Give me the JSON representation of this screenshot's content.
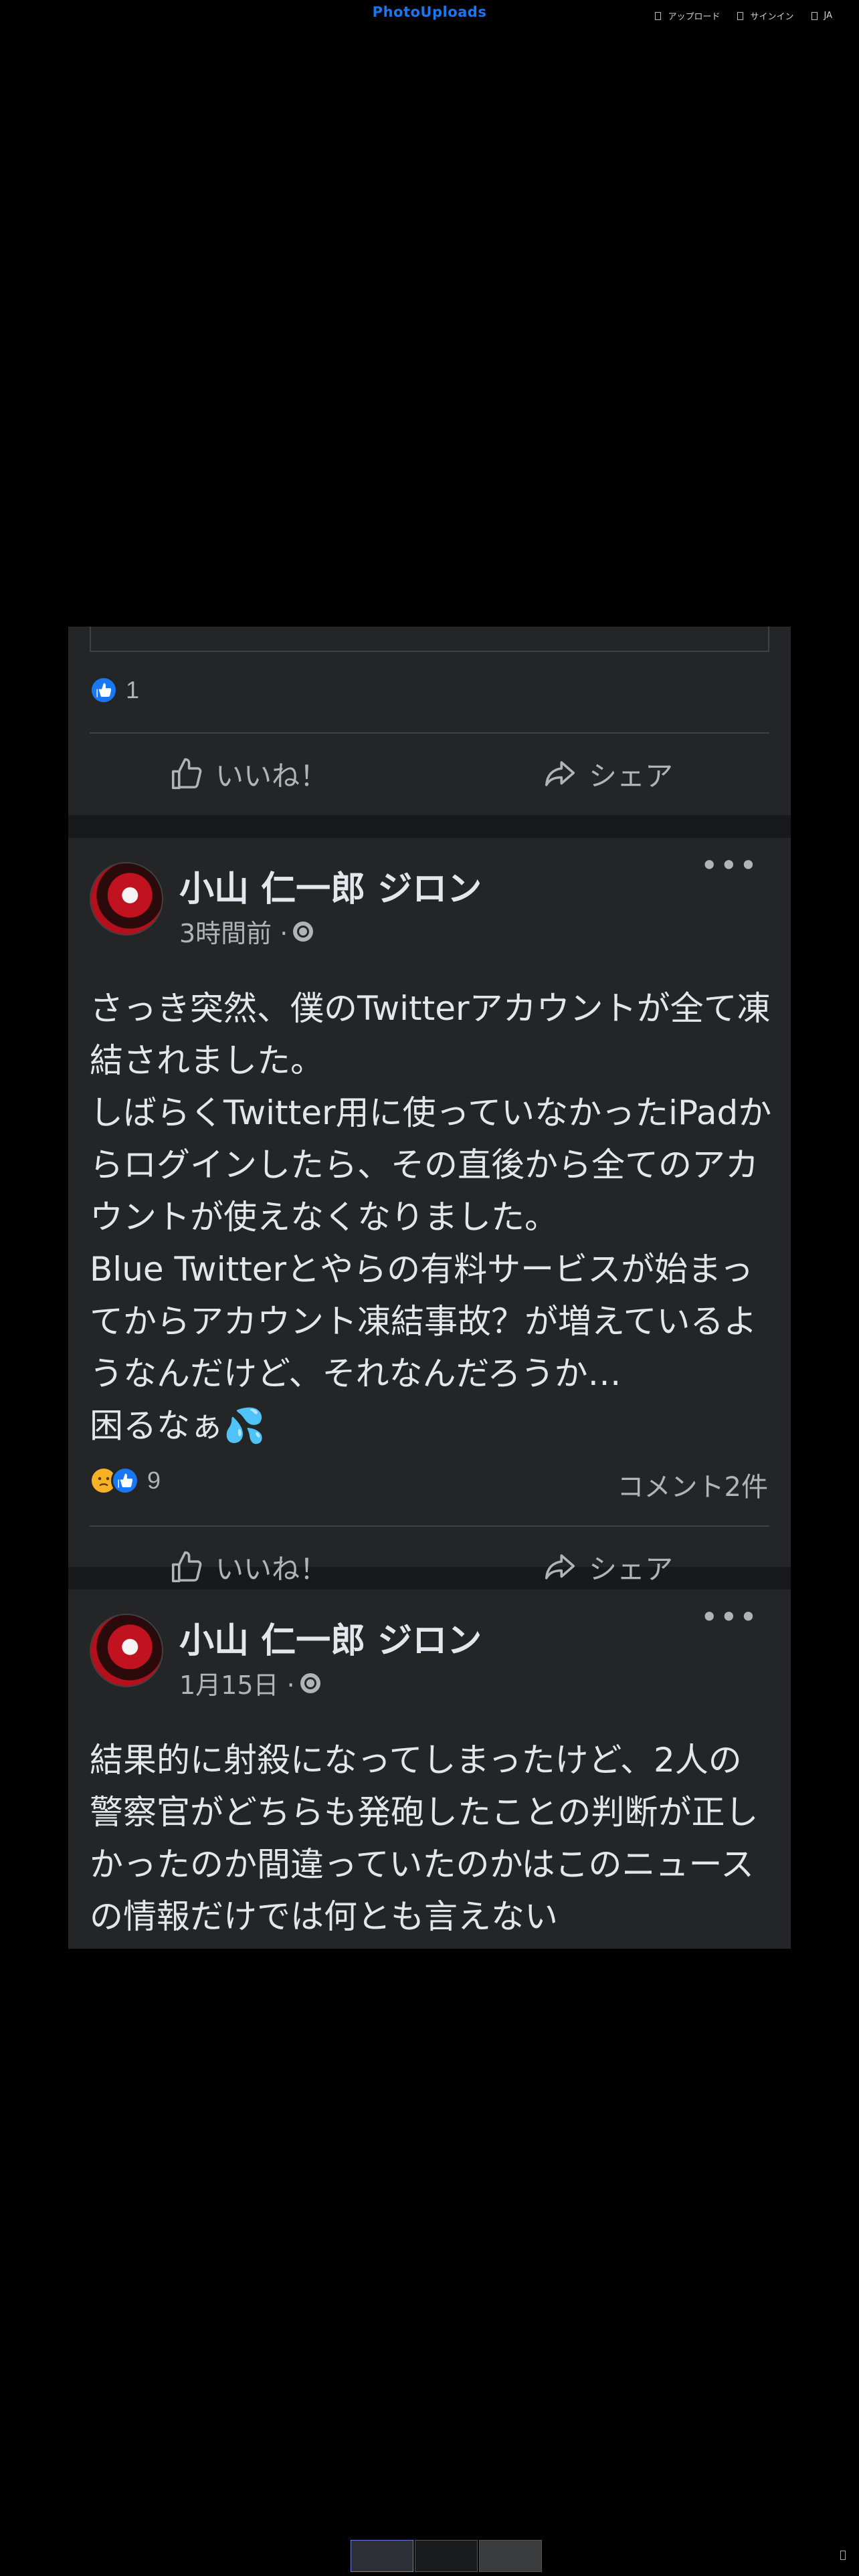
{
  "site": {
    "logo": "PhotoUploads",
    "nav": [
      {
        "icon": "upload-icon",
        "label": "アップロード"
      },
      {
        "icon": "signin-icon",
        "label": "サインイン"
      },
      {
        "icon": "language-icon",
        "label": "JA"
      }
    ]
  },
  "post_prev": {
    "reaction_count": "1",
    "like_label": "いいね！",
    "share_label": "シェア"
  },
  "post_main": {
    "author": "小山 仁一郎 ジロン",
    "time": "3時間前 ·",
    "text": [
      "さっき突然、僕のTwitterアカウントが全て凍結されました。",
      "しばらくTwitter用に使っていなかったiPadからログインしたら、その直後から全てのアカウントが使えなくなりました。",
      "Blue Twitterとやらの有料サービスが始まってからアカウント凍結事故？が増えているようなんだけど、それなんだろうか…",
      "困るなぁ💦"
    ],
    "reaction_count": "9",
    "comments": "コメント2件",
    "like_label": "いいね！",
    "share_label": "シェア"
  },
  "post_next": {
    "author": "小山 仁一郎 ジロン",
    "time": "1月15日 ·",
    "text": [
      "結果的に射殺になってしまったけど、2人の警察官がどちらも発砲したことの判断が正しかったのか間違っていたのかはこのニュースの情報だけでは何とも言えない"
    ]
  },
  "colors": {
    "brand": "#1877f2",
    "card": "#242526",
    "panel": "#18191a",
    "text": "#e4e6eb",
    "muted": "#b0b3b8"
  }
}
